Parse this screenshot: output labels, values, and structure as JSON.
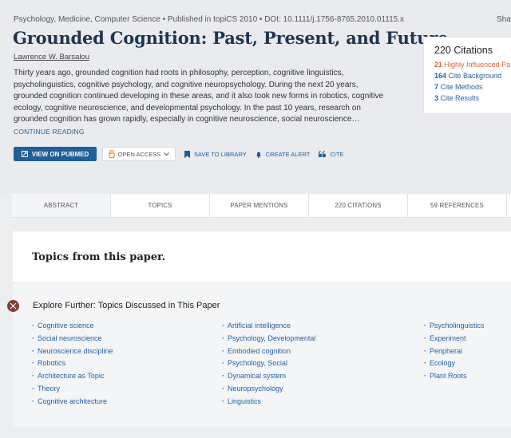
{
  "paper": {
    "meta": "Psychology, Medicine, Computer Science • Published in topiCS 2010 • DOI: 10.1111/j.1756-8765.2010.01115.x",
    "share": "Share",
    "title": "Grounded Cognition: Past, Present, and Future",
    "author": "Lawrence W. Barsalou",
    "abstract": "Thirty years ago, grounded cognition had roots in philosophy, perception, cognitive linguistics, psycholinguistics, cognitive psychology, and cognitive neuropsychology. During the next 20 years, grounded cognition continued developing in these areas, and it also took new forms in robotics, cognitive ecology, cognitive neuroscience, and developmental psychology. In the past 10 years, research on grounded cognition has grown rapidly, especially in cognitive neuroscience, social neuroscience… ",
    "continue_label": "Continue Reading"
  },
  "actions": {
    "view_pubmed": "View on PubMed",
    "open_access": "Open Access",
    "save": "Save to Library",
    "alert": "Create Alert",
    "cite": "Cite"
  },
  "citations": {
    "header": "220 Citations",
    "items": [
      {
        "count": "21",
        "label": "Highly Influenced Pa",
        "highlight": true
      },
      {
        "count": "164",
        "label": "Cite Background",
        "highlight": false
      },
      {
        "count": "7",
        "label": "Cite Methods",
        "highlight": false
      },
      {
        "count": "3",
        "label": "Cite Results",
        "highlight": false
      }
    ]
  },
  "tabs": [
    "Abstract",
    "Topics",
    "Paper Mentions",
    "220 Citations",
    "59 References"
  ],
  "topics_section": {
    "title": "Topics from this paper.",
    "explore_title": "Explore Further: Topics Discussed in This Paper",
    "col1": [
      "Cognitive science",
      "Social neuroscience",
      "Neuroscience discipline",
      "Robotics",
      "Architecture as Topic",
      "Theory",
      "Cognitive architecture"
    ],
    "col2": [
      "Artificial intelligence",
      "Psychology, Developmental",
      "Embodied cognition",
      "Psychology, Social",
      "Dynamical system",
      "Neuropsychology",
      "Linguistics"
    ],
    "col3": [
      "Psycholinguistics",
      "Experiment",
      "Peripheral",
      "Ecology",
      "Plant Roots"
    ]
  },
  "colors": {
    "accent": "#1f5e96",
    "link": "#2463a4",
    "highlight": "#e2613b",
    "title": "#1f3550"
  }
}
